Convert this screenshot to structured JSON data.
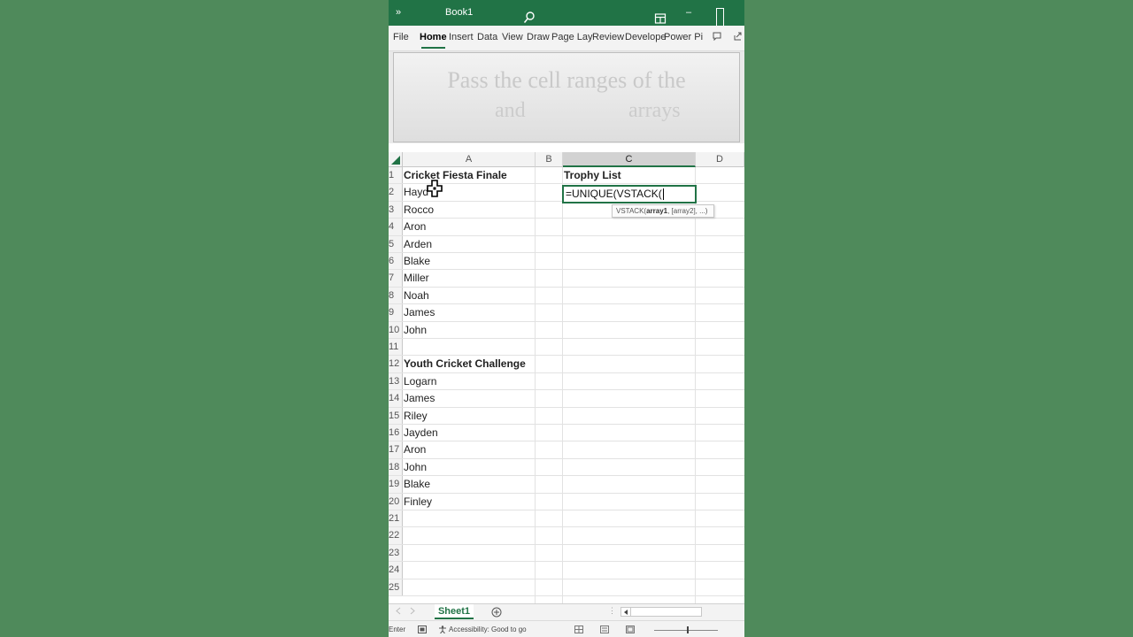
{
  "window": {
    "title": "Book1",
    "more_glyph": "»",
    "minimize_glyph": "–"
  },
  "ribbon": {
    "tabs": [
      "File",
      "Home",
      "Insert",
      "Data",
      "View",
      "Draw",
      "Page Lay",
      "Review",
      "Develope",
      "Power Pi"
    ],
    "active_tab": "Home",
    "accent_color": "#217346"
  },
  "banner": {
    "line1": "Pass the cell ranges of the",
    "line2_word1": "and",
    "line2_word2": "arrays"
  },
  "sheet": {
    "columns": [
      "A",
      "B",
      "C",
      "D"
    ],
    "selected_column": "C",
    "rows": [
      {
        "num": "1",
        "a": "Cricket Fiesta Finale",
        "a_bold": true,
        "c": "Trophy List",
        "c_bold": true
      },
      {
        "num": "2",
        "a": "Hayd",
        "c": ""
      },
      {
        "num": "3",
        "a": "Rocco"
      },
      {
        "num": "4",
        "a": "Aron"
      },
      {
        "num": "5",
        "a": "Arden"
      },
      {
        "num": "6",
        "a": "Blake"
      },
      {
        "num": "7",
        "a": "Miller"
      },
      {
        "num": "8",
        "a": "Noah"
      },
      {
        "num": "9",
        "a": "James"
      },
      {
        "num": "10",
        "a": "John"
      },
      {
        "num": "11",
        "a": ""
      },
      {
        "num": "12",
        "a": "Youth Cricket Challenge",
        "a_bold": true
      },
      {
        "num": "13",
        "a": "Logarn"
      },
      {
        "num": "14",
        "a": "James"
      },
      {
        "num": "15",
        "a": "Riley"
      },
      {
        "num": "16",
        "a": "Jayden"
      },
      {
        "num": "17",
        "a": "Aron"
      },
      {
        "num": "18",
        "a": "John"
      },
      {
        "num": "19",
        "a": "Blake"
      },
      {
        "num": "20",
        "a": "Finley"
      },
      {
        "num": "21",
        "a": ""
      },
      {
        "num": "22",
        "a": ""
      },
      {
        "num": "23",
        "a": ""
      },
      {
        "num": "24",
        "a": ""
      },
      {
        "num": "25",
        "a": ""
      }
    ],
    "active_cell_formula": "=UNIQUE(VSTACK(",
    "tooltip": {
      "fn": "VSTACK(",
      "arg1": "array1",
      "rest": ", [array2], ...)"
    }
  },
  "sheet_tabs": {
    "active": "Sheet1"
  },
  "status": {
    "mode": "Enter",
    "accessibility": "Accessibility: Good to go"
  }
}
